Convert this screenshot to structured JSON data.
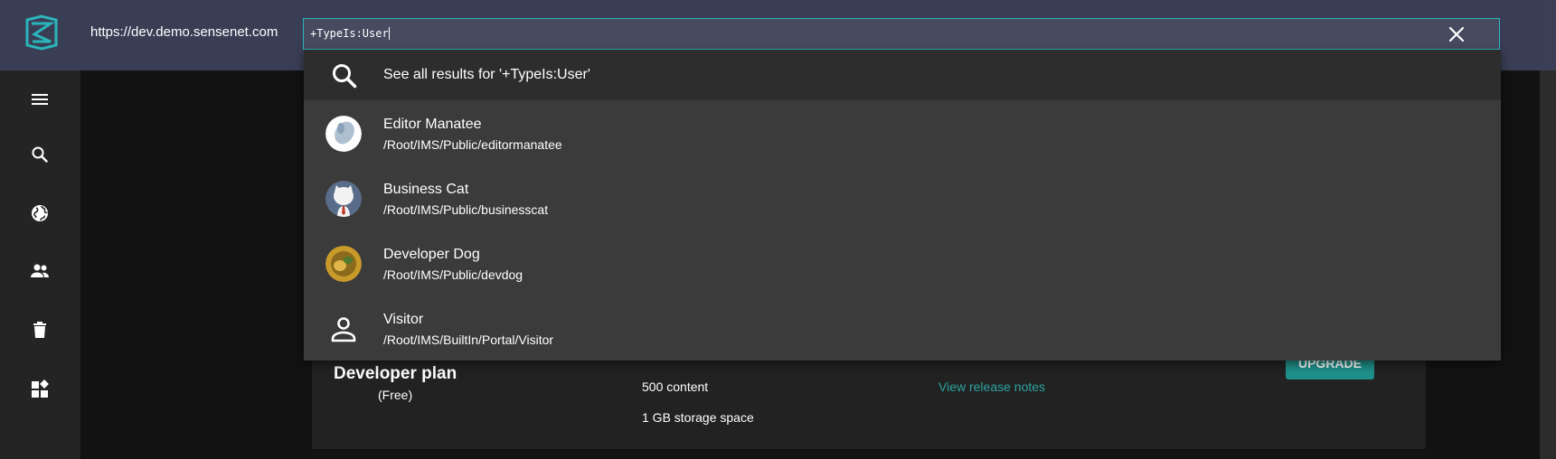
{
  "header": {
    "site_url": "https://dev.demo.sensenet.com",
    "search_value": "+TypeIs:User"
  },
  "sidebar": {
    "items": [
      {
        "icon": "menu-icon"
      },
      {
        "icon": "search-icon"
      },
      {
        "icon": "globe-icon"
      },
      {
        "icon": "people-icon"
      },
      {
        "icon": "trash-icon"
      },
      {
        "icon": "widgets-icon"
      }
    ]
  },
  "search_dropdown": {
    "see_all_label": "See all results for '+TypeIs:User'",
    "results": [
      {
        "title": "Editor Manatee",
        "path": "/Root/IMS/Public/editormanatee"
      },
      {
        "title": "Business Cat",
        "path": "/Root/IMS/Public/businesscat"
      },
      {
        "title": "Developer Dog",
        "path": "/Root/IMS/Public/devdog"
      },
      {
        "title": "Visitor",
        "path": "/Root/IMS/BuiltIn/Portal/Visitor"
      }
    ]
  },
  "plan": {
    "title": "Developer plan",
    "subtitle": "(Free)",
    "features": [
      "500 content",
      "1 GB storage space"
    ],
    "release_notes_label": "View release notes",
    "upgrade_label": "UPGRADE"
  },
  "colors": {
    "header_bg": "#393e55",
    "accent": "#2bb5bb",
    "link": "#2ba3a0",
    "upgrade_bg": "#1f8f89"
  }
}
